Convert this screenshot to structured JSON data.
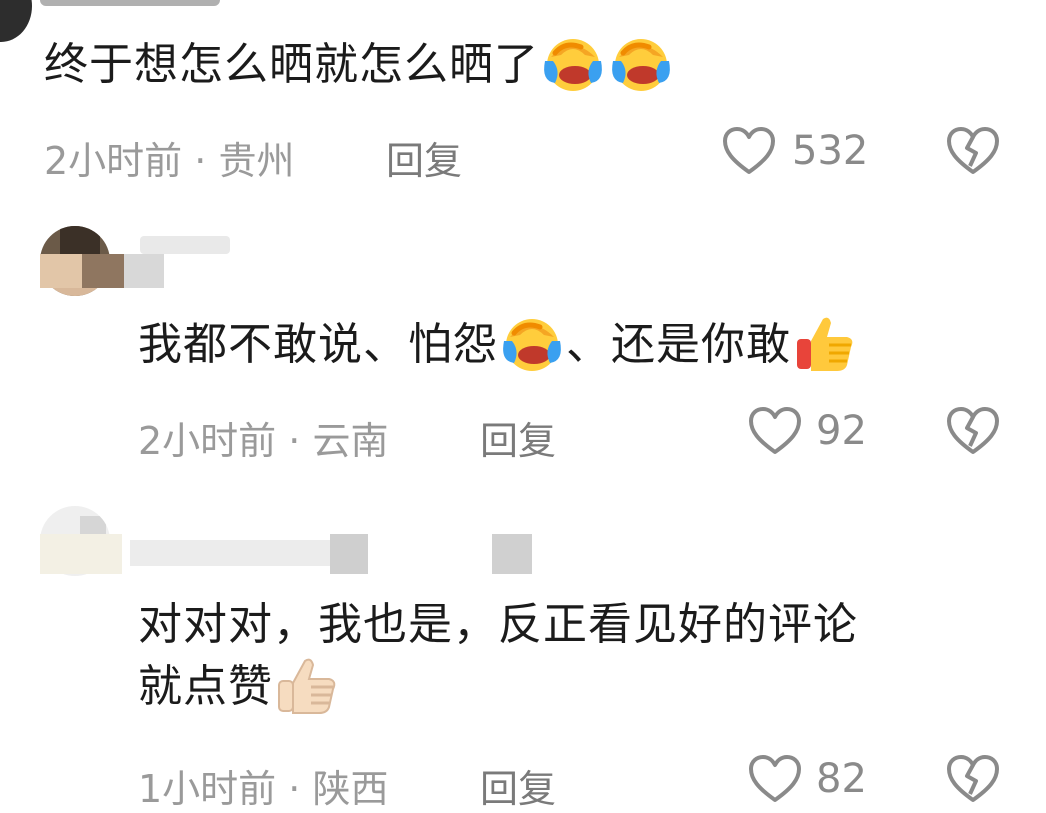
{
  "comments": [
    {
      "text": "终于想怎么晒就怎么晒了",
      "time": "2小时前",
      "location": "贵州",
      "reply_label": "回复",
      "likes": "532"
    },
    {
      "text_parts": [
        "我都不敢说、怕怨",
        "、还是你敢"
      ],
      "time": "2小时前",
      "location": "云南",
      "reply_label": "回复",
      "likes": "92"
    },
    {
      "text_line1": "对对对，我也是，反正看见好的评论",
      "text_line2": "就点赞",
      "time": "1小时前",
      "location": "陕西",
      "reply_label": "回复",
      "likes": "82"
    }
  ],
  "separator": "·",
  "icons": {
    "like": "heart-outline-icon",
    "dislike": "broken-heart-icon",
    "laugh": "face-with-tears-of-joy-icon",
    "thumbs_up": "thumbs-up-icon"
  },
  "colors": {
    "text": "#1b1b1b",
    "meta": "#9a9a9a",
    "icon": "#8a8a8a"
  }
}
